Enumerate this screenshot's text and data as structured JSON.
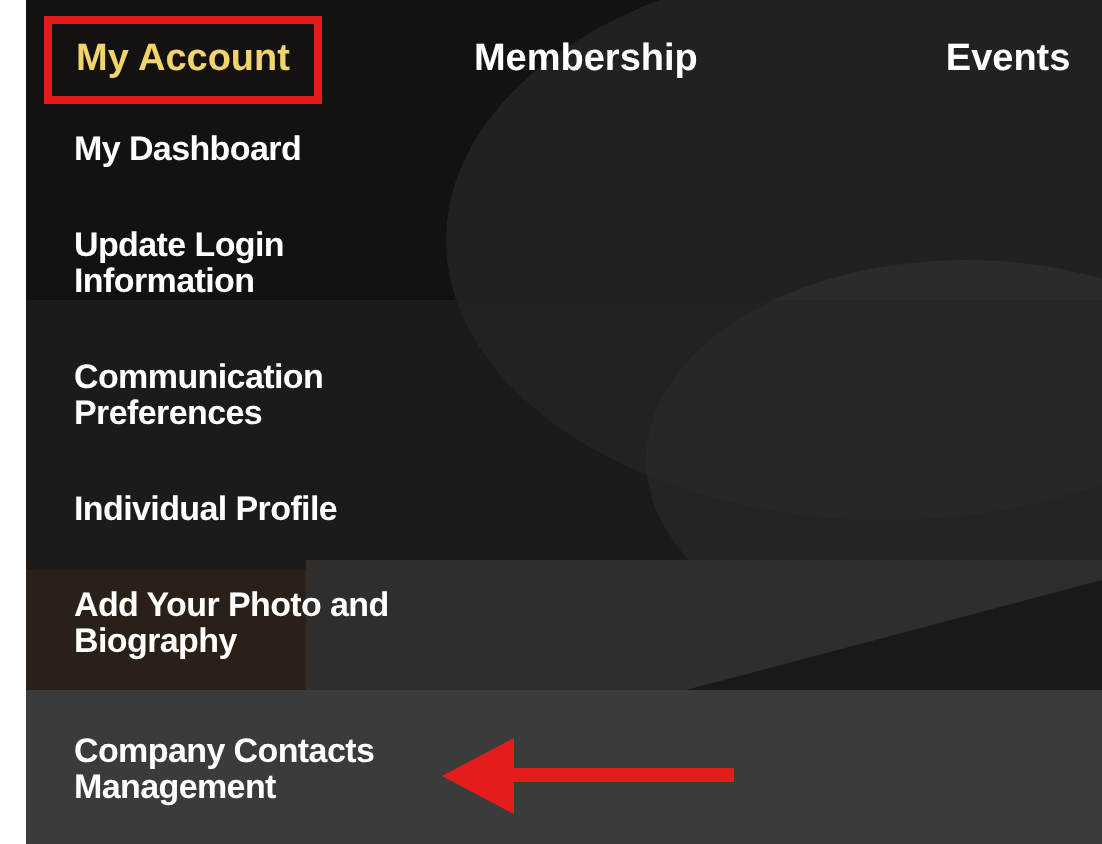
{
  "nav": [
    {
      "label": "My Account",
      "selected": true,
      "outlined": true
    },
    {
      "label": "Membership",
      "selected": false,
      "outlined": false
    },
    {
      "label": "Events",
      "selected": false,
      "outlined": false
    }
  ],
  "menu": [
    {
      "label": "My Dashboard",
      "highlighted": false,
      "pointed_at": false
    },
    {
      "label": "Update Login Information",
      "highlighted": false,
      "pointed_at": false
    },
    {
      "label": "Communication Preferences",
      "highlighted": false,
      "pointed_at": false
    },
    {
      "label": "Individual Profile",
      "highlighted": false,
      "pointed_at": false
    },
    {
      "label": "Add Your Photo and Biography",
      "highlighted": false,
      "pointed_at": false
    },
    {
      "label": "Company Contacts Management",
      "highlighted": true,
      "pointed_at": true
    }
  ]
}
